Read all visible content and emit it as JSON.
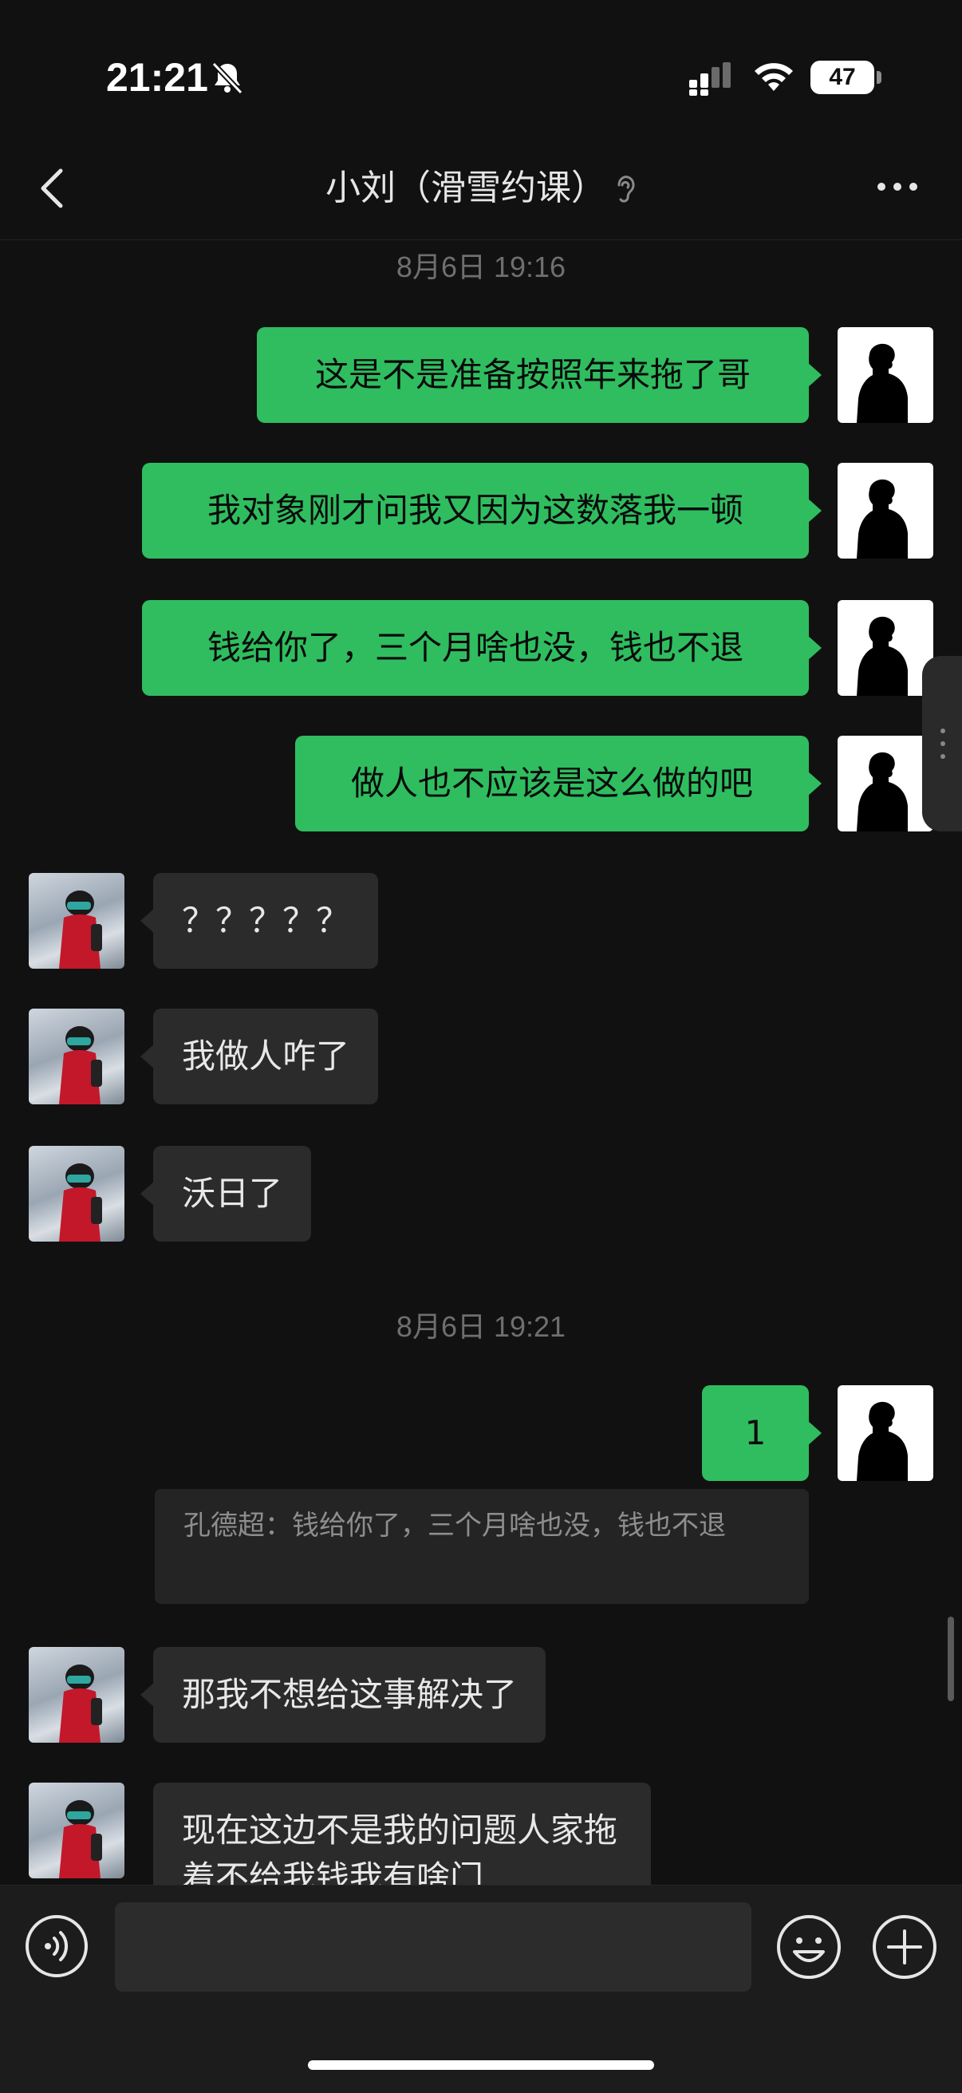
{
  "status_bar": {
    "time": "21:21",
    "battery": "47"
  },
  "header": {
    "title": "小刘（滑雪约课）",
    "back_icon": "chevron-left-icon",
    "more_icon": "ellipsis-icon",
    "mode_icon": "ear-icon"
  },
  "messages": {
    "ts1": "8月6日 19:16",
    "m1": "这是不是准备按照年来拖了哥",
    "m2": "我对象刚才问我又因为这数落我一顿",
    "m3": "钱给你了，三个月啥也没，钱也不退",
    "m4": "做人也不应该是这么做的吧",
    "m5": "？？？？？",
    "m6": "我做人咋了",
    "m7": "沃日了",
    "ts2": "8月6日 19:21",
    "m8": "1",
    "quote": "孔德超：钱给你了，三个月啥也没，钱也不退",
    "m9": "那我不想给这事解决了",
    "m10": "现在这边不是我的问题人家拖着不给我钱我有啥门"
  },
  "input": {
    "placeholder": ""
  },
  "colors": {
    "background": "#111111",
    "outgoing_bubble": "#2fbd5f",
    "incoming_bubble": "#2b2b2b",
    "timestamp": "#6f6f6f"
  }
}
